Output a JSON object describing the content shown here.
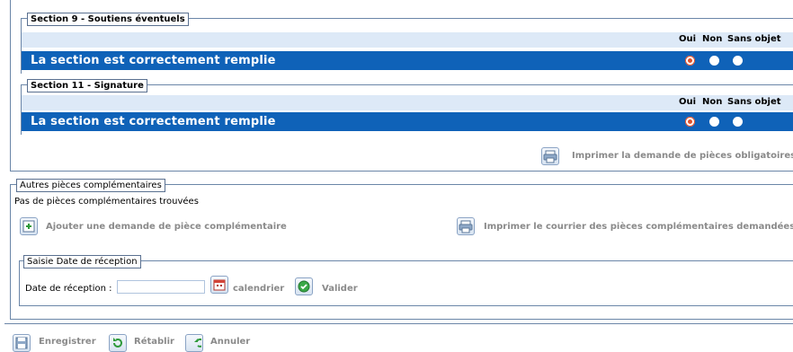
{
  "section9": {
    "legend": "Section 9 - Soutiens éventuels",
    "col_oui": "Oui",
    "col_non": "Non",
    "col_sans_objet": "Sans objet",
    "row_label": "La section est correctement remplie",
    "selected": "Oui"
  },
  "section11": {
    "legend": "Section 11 - Signature",
    "col_oui": "Oui",
    "col_non": "Non",
    "col_sans_objet": "Sans objet",
    "row_label": "La section est correctement remplie",
    "selected": "Oui"
  },
  "print_mandatory_label": "Imprimer la demande de pièces obligatoires",
  "complementary": {
    "legend": "Autres pièces complémentaires",
    "empty_text": "Pas de pièces complémentaires trouvées",
    "add_label": "Ajouter une demande de pièce complémentaire",
    "print_label": "Imprimer le courrier des pièces complémentaires demandées"
  },
  "reception": {
    "legend": "Saisie Date de réception",
    "date_label": "Date de réception :",
    "date_value": "",
    "calendar_label": "calendrier",
    "validate_label": "Valider"
  },
  "footer": {
    "save_label": "Enregistrer",
    "restore_label": "Rétablir",
    "cancel_label": "Annuler"
  },
  "colors": {
    "row_blue": "#0f62b8",
    "header_row": "#dde9f7",
    "radio_selected": "#e0502a"
  },
  "icons": [
    "printer-icon",
    "add-document-icon",
    "calendar-icon",
    "validate-icon",
    "save-icon",
    "restore-icon",
    "cancel-icon"
  ]
}
